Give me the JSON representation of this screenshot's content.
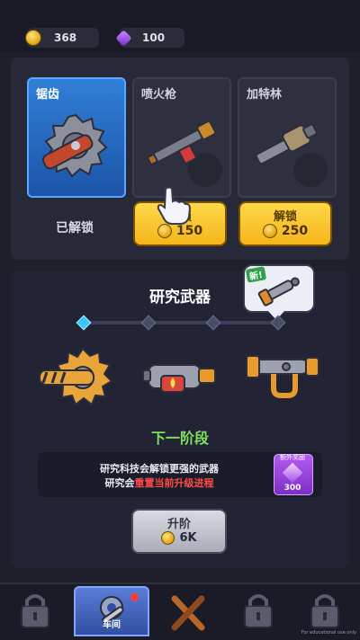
{
  "resources": {
    "coins": "368",
    "gems": "100"
  },
  "weapons": [
    {
      "name": "锯齿",
      "status": "已解锁",
      "selected": true
    },
    {
      "name": "喷火枪",
      "button": "解锁",
      "price": "150"
    },
    {
      "name": "加特林",
      "button": "解锁",
      "price": "250"
    }
  ],
  "research": {
    "title": "研究武器",
    "new_tag": "新!",
    "stage": "下一阶段",
    "info_line1": "研究科技会解锁更强的武器",
    "info_line2_prefix": "研究会",
    "info_line2_red": "重置当前升级进程",
    "bonus_label": "额外奖励",
    "bonus_value": "300",
    "upgrade_label": "升阶",
    "upgrade_price": "6K"
  },
  "nav": {
    "active_label": "车间"
  },
  "watermark": "For educational use only",
  "colors": {
    "accent_blue": "#2f7fd6",
    "gold": "#f5b51b",
    "green": "#7ee25a",
    "red": "#ff4a4a"
  }
}
